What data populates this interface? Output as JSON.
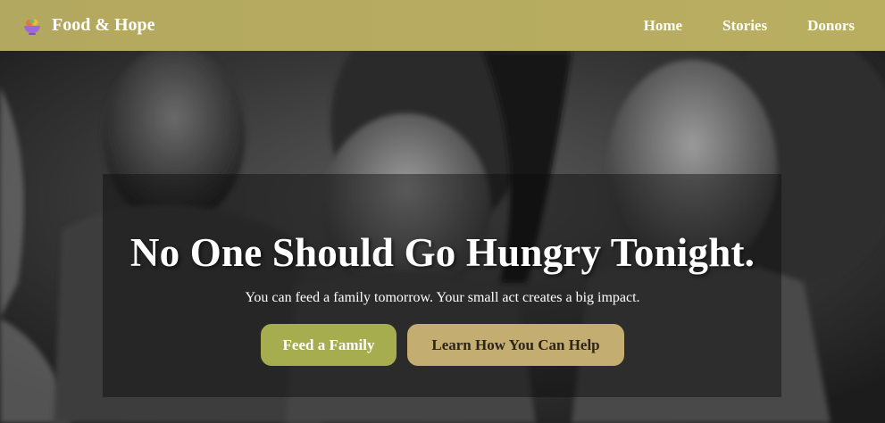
{
  "header": {
    "brand": "Food & Hope",
    "nav": [
      {
        "label": "Home"
      },
      {
        "label": "Stories"
      },
      {
        "label": "Donors"
      }
    ]
  },
  "hero": {
    "title": "No One Should Go Hungry Tonight.",
    "subtitle": "You can feed a family tomorrow. Your small act creates a big impact.",
    "primary_cta": "Feed a Family",
    "secondary_cta": "Learn How You Can Help"
  },
  "colors": {
    "header_bg": "#b5aa5f",
    "primary_button": "#a6ad4f",
    "secondary_button": "#c3ad70"
  },
  "icons": {
    "brand": "food-bowl-icon"
  }
}
